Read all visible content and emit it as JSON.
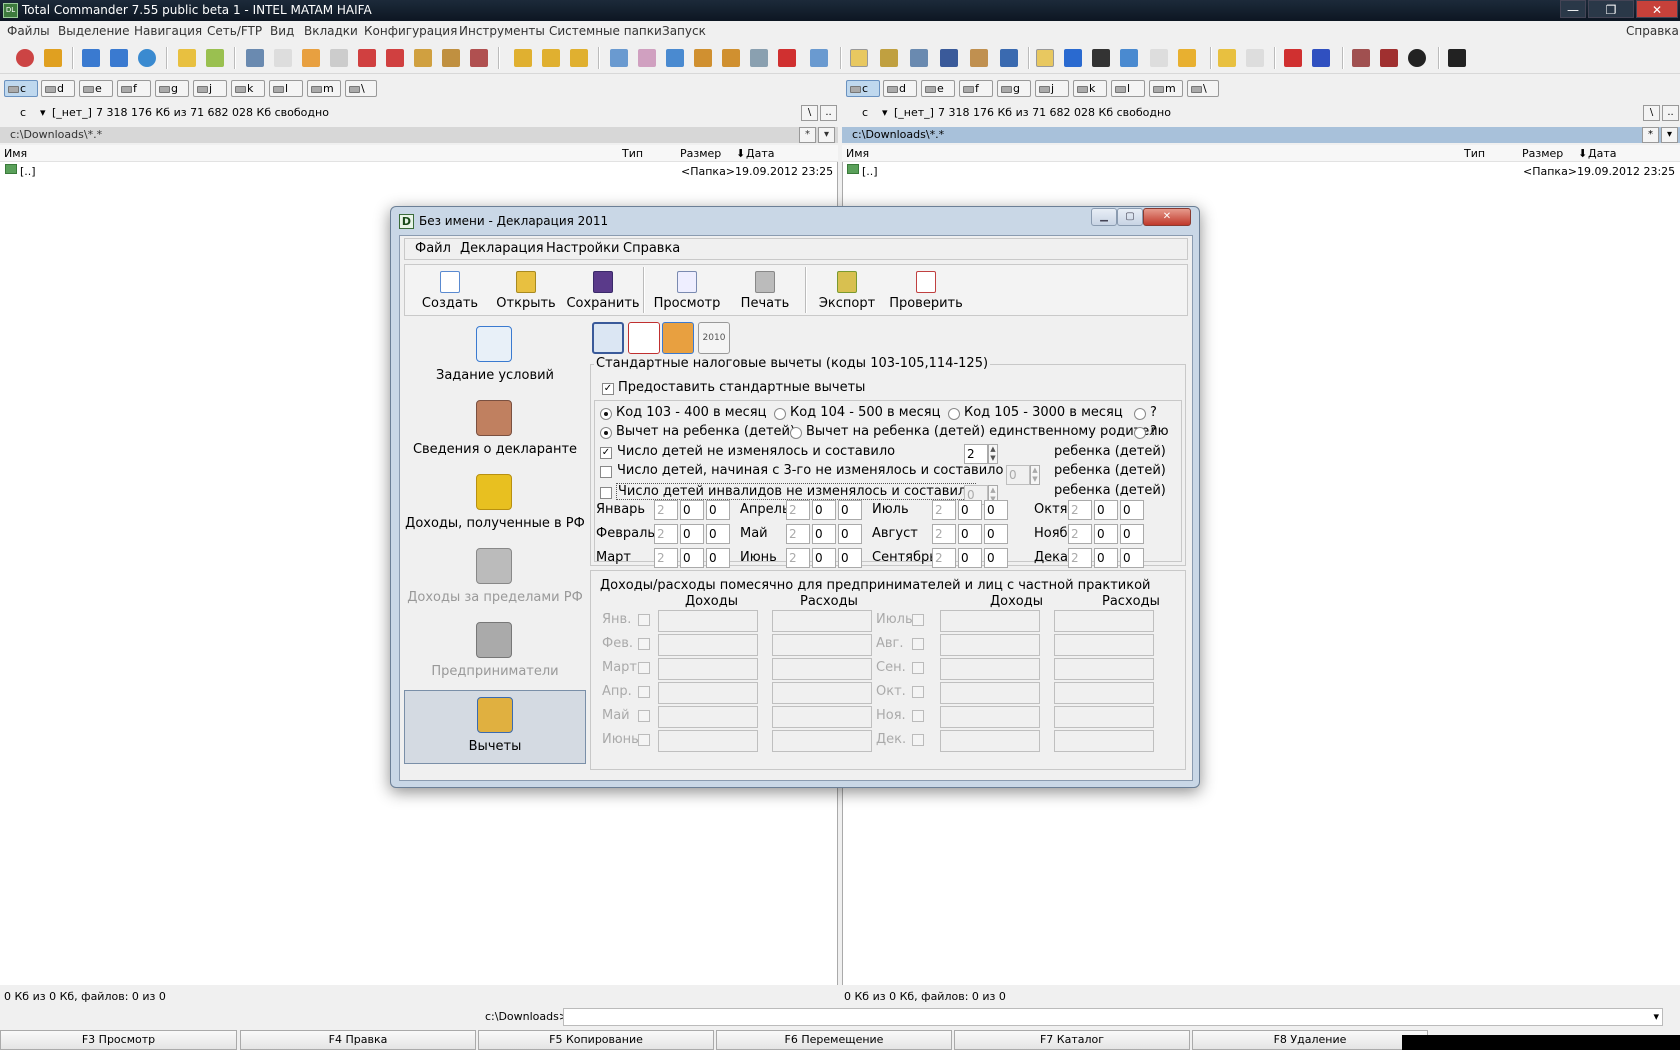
{
  "window": {
    "title": "Total Commander 7.55 public beta 1 - INTEL MATAM HAIFA",
    "app_icon_label": "DL",
    "minimize": "—",
    "maximize": "❐",
    "close": "✕"
  },
  "menu": [
    "Файлы",
    "Выделение",
    "Навигация",
    "Сеть/FTP",
    "Вид",
    "Вкладки",
    "Конфигурация",
    "Инструменты",
    "Системные папки",
    "Запуск"
  ],
  "menu_help": "Справка",
  "drives": [
    "c",
    "d",
    "e",
    "f",
    "g",
    "j",
    "k",
    "l",
    "m",
    "\\"
  ],
  "left": {
    "drive": "c",
    "volume": "[_нет_]",
    "free": "7 318 176 Кб из 71 682 028 Кб свободно",
    "path": "c:\\Downloads\\*.*",
    "col_name": "Имя",
    "col_type": "Тип",
    "col_size": "Размер",
    "col_date": "Дата",
    "up_name": "[..]",
    "up_size": "<Папка>",
    "up_date": "19.09.2012 23:25",
    "status": "0 Кб из 0 Кб, файлов: 0 из 0"
  },
  "right": {
    "drive": "c",
    "volume": "[_нет_]",
    "free": "7 318 176 Кб из 71 682 028 Кб свободно",
    "path": "c:\\Downloads\\*.*",
    "col_name": "Имя",
    "col_type": "Тип",
    "col_size": "Размер",
    "col_date": "Дата",
    "up_name": "[..]",
    "up_size": "<Папка>",
    "up_date": "19.09.2012 23:25",
    "status": "0 Кб из 0 Кб, файлов: 0 из 0"
  },
  "panel_btn_root": "\\",
  "panel_btn_up": "..",
  "panel_btn_star": "*",
  "panel_btn_down": "▾",
  "sort_arrow": "⬇",
  "cmdline": {
    "prompt": "c:\\Downloads>",
    "arrow": "▾"
  },
  "fkeys": [
    "F3 Просмотр",
    "F4 Правка",
    "F5 Копирование",
    "F6 Перемещение",
    "F7 Каталог",
    "F8 Удаление"
  ],
  "dialog": {
    "title": "Без имени - Декларация 2011",
    "icon_letter": "D",
    "menu": [
      "Файл",
      "Декларация",
      "Настройки",
      "Справка"
    ],
    "toolbar": [
      "Создать",
      "Открыть",
      "Сохранить",
      "Просмотр",
      "Печать",
      "Экспорт",
      "Проверить"
    ],
    "nav": [
      "Задание условий",
      "Сведения о декларанте",
      "Доходы, полученные в РФ",
      "Доходы за пределами РФ",
      "Предприниматели",
      "Вычеты"
    ],
    "tab4_label": "2010",
    "std": {
      "group_title": "Стандартные налоговые вычеты (коды 103-105,114-125)",
      "provide": "Предоставить стандартные вычеты",
      "code103": "Код 103 - 400 в месяц",
      "code104": "Код 104 - 500 в месяц",
      "code105": "Код 105 - 3000 в месяц",
      "q": "?",
      "child": "Вычет на ребенка (детей)",
      "child_single": "Вычет на ребенка (детей) единственному родителю",
      "unchanged": "Число детей не изменялось и составило",
      "unchanged_val": "2",
      "from3": "Число детей, начиная с 3-го не изменялось и составило",
      "from3_val": "0",
      "disabled": "Число детей инвалидов не изменялось и составило",
      "disabled_val": "0",
      "unit": "ребенка (детей)",
      "months": [
        {
          "name": "Январь",
          "v": [
            "2",
            "0",
            "0"
          ]
        },
        {
          "name": "Февраль",
          "v": [
            "2",
            "0",
            "0"
          ]
        },
        {
          "name": "Март",
          "v": [
            "2",
            "0",
            "0"
          ]
        },
        {
          "name": "Апрель",
          "v": [
            "2",
            "0",
            "0"
          ]
        },
        {
          "name": "Май",
          "v": [
            "2",
            "0",
            "0"
          ]
        },
        {
          "name": "Июнь",
          "v": [
            "2",
            "0",
            "0"
          ]
        },
        {
          "name": "Июль",
          "v": [
            "2",
            "0",
            "0"
          ]
        },
        {
          "name": "Август",
          "v": [
            "2",
            "0",
            "0"
          ]
        },
        {
          "name": "Сентябрь",
          "v": [
            "2",
            "0",
            "0"
          ]
        },
        {
          "name": "Октябрь",
          "v": [
            "2",
            "0",
            "0"
          ]
        },
        {
          "name": "Ноябрь",
          "v": [
            "2",
            "0",
            "0"
          ]
        },
        {
          "name": "Декабрь",
          "v": [
            "2",
            "0",
            "0"
          ]
        }
      ]
    },
    "biz": {
      "title": "Доходы/расходы помесячно для предпринимателей и лиц с частной практикой",
      "income": "Доходы",
      "expense": "Расходы",
      "left_months": [
        "Янв.",
        "Фев.",
        "Март",
        "Апр.",
        "Май",
        "Июнь"
      ],
      "right_months": [
        "Июль",
        "Авг.",
        "Сен.",
        "Окт.",
        "Ноя.",
        "Дек."
      ]
    }
  }
}
